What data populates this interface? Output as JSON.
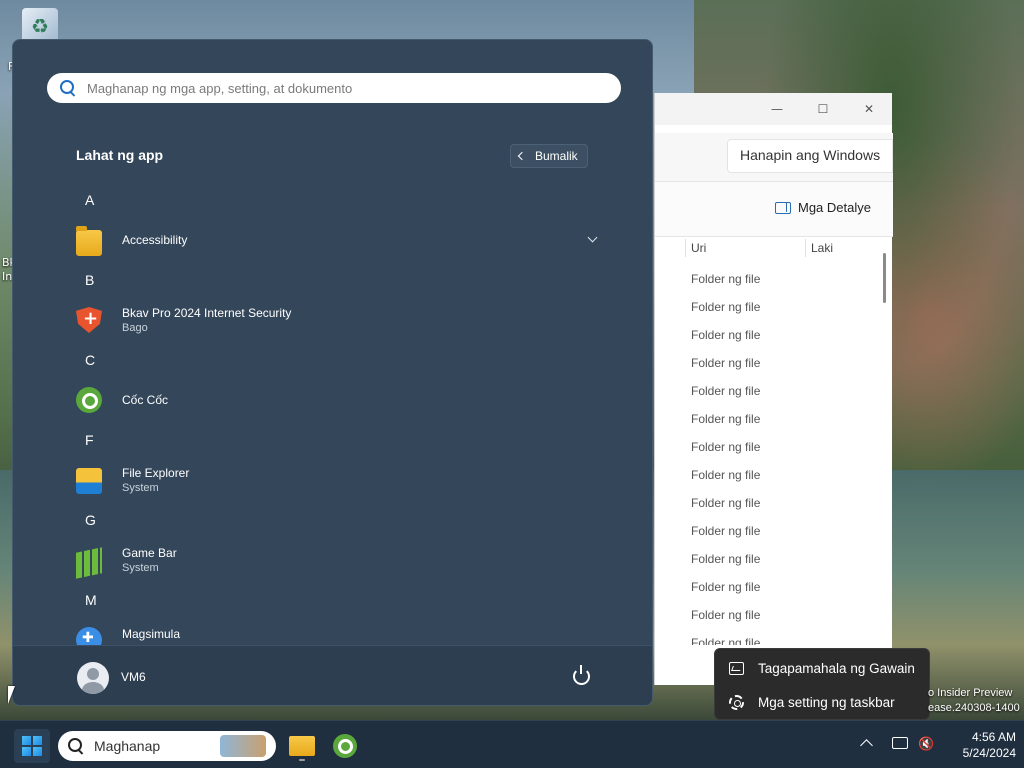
{
  "desktop": {
    "edge_labels": [
      "F",
      "Bk",
      "In"
    ],
    "watermark": [
      "o Insider Preview",
      "ease.240308-1400"
    ]
  },
  "explorer": {
    "search": "Hanapin ang Windows",
    "details_label": "Mga Detalye",
    "col_type": "Uri",
    "col_size": "Laki",
    "rows": [
      "Folder ng file",
      "Folder ng file",
      "Folder ng file",
      "Folder ng file",
      "Folder ng file",
      "Folder ng file",
      "Folder ng file",
      "Folder ng file",
      "Folder ng file",
      "Folder ng file",
      "Folder ng file",
      "Folder ng file",
      "Folder ng file",
      "Folder ng file"
    ]
  },
  "start": {
    "search_placeholder": "Maghanap ng mga app, setting, at dokumento",
    "all_apps_title": "Lahat ng app",
    "back_label": "Bumalik",
    "letters": {
      "a": "A",
      "b": "B",
      "c": "C",
      "f": "F",
      "g": "G",
      "m": "M"
    },
    "apps": {
      "accessibility": {
        "name": "Accessibility",
        "icon": "folder-icon"
      },
      "bkav": {
        "name": "Bkav Pro 2024 Internet Security",
        "sub": "Bago",
        "icon": "shield-icon"
      },
      "coccoc": {
        "name": "Cốc Cốc",
        "icon": "coccoc-icon"
      },
      "fileexplorer": {
        "name": "File Explorer",
        "sub": "System",
        "icon": "file-explorer-icon"
      },
      "gamebar": {
        "name": "Game Bar",
        "sub": "System",
        "icon": "game-bar-icon"
      },
      "magsimula": {
        "name": "Magsimula",
        "icon": "get-started-icon"
      }
    },
    "user": "VM6"
  },
  "context_menu": {
    "task_manager": "Tagapamahala ng Gawain",
    "taskbar_settings": "Mga setting ng taskbar"
  },
  "taskbar": {
    "search_label": "Maghanap",
    "time": "4:56 AM",
    "date": "5/24/2024"
  },
  "colors": {
    "start_bg": "#344659",
    "taskbar_bg": "#1f2f3f",
    "accent": "#1e6fc2"
  }
}
